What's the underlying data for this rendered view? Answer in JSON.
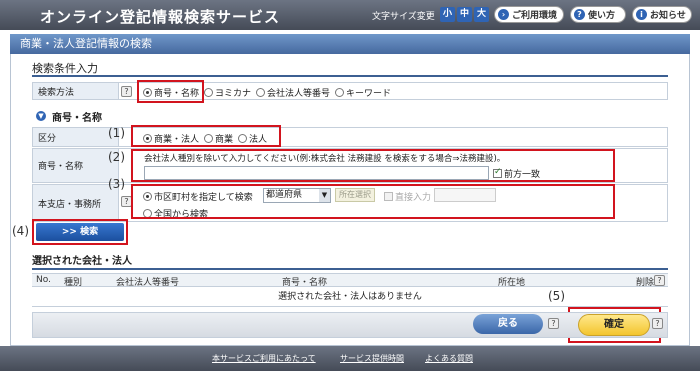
{
  "header": {
    "site_title": "オンライン登記情報検索サービス",
    "font_size_label": "文字サイズ変更",
    "font_sizes": [
      "小",
      "中",
      "大"
    ],
    "env_button": "ご利用環境",
    "howto_button": "使い方",
    "notice_button": "お知らせ"
  },
  "page_title": "商業・法人登記情報の検索",
  "search_conditions": {
    "heading": "検索条件入力",
    "method_label": "検索方法",
    "methods": [
      "商号・名称",
      "ヨミカナ",
      "会社法人等番号",
      "キーワード"
    ],
    "selected_method": "商号・名称"
  },
  "name_section": {
    "heading": "商号・名称",
    "kubun_label": "区分",
    "kubun_options": [
      "商業・法人",
      "商業",
      "法人"
    ],
    "name_label": "商号・名称",
    "name_hint": "会社法人種別を除いて入力してください(例:株式会社 法務建設 を検索をする場合⇒法務建設)。",
    "name_value": "",
    "prefix_match_label": "前方一致",
    "office_label": "本支店・事務所",
    "city_option": "市区町村を指定して検索",
    "prefecture_value": "都道府県",
    "location_select_button": "所在選択",
    "direct_input_label": "直接入力",
    "nationwide_option": "全国から検索",
    "search_button": ">> 検索"
  },
  "markers": [
    "(1)",
    "(2)",
    "(3)",
    "(4)",
    "(5)"
  ],
  "selected_corps": {
    "heading": "選択された会社・法人",
    "columns": [
      "No.",
      "種別",
      "会社法人等番号",
      "商号・名称",
      "所在地",
      "削除"
    ],
    "empty_message": "選択された会社・法人はありません"
  },
  "actions": {
    "back_label": "戻る",
    "confirm_label": "確定"
  },
  "footer": {
    "links": [
      "本サービスご利用にあたって",
      "サービス提供時間",
      "よくある質問"
    ]
  },
  "colors": {
    "header_bg": "#545a66",
    "title_bar": "#5a80b6",
    "highlight": "#d2141e",
    "confirm": "#f3c52e"
  }
}
